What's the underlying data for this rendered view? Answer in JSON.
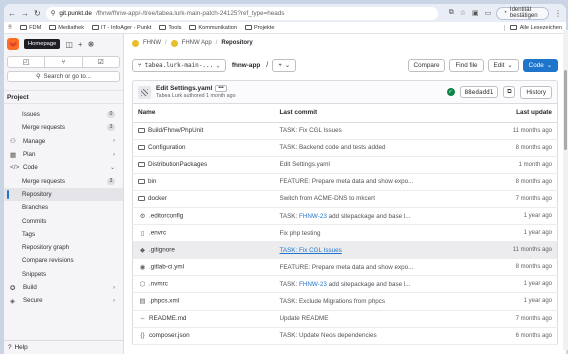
{
  "browser": {
    "url_host": "git.punkt.de",
    "url_path": "/fhnw/fhnw-app/-/tree/tabea.lurk-main-patch-24125?ref_type=heads",
    "verify_label": "Identität bestätigen",
    "bookmarks": [
      "FDM",
      "Mediathek",
      "IT - InfoAger - Punkt",
      "Tools",
      "Kommunikation",
      "Projekte"
    ],
    "all_bookmarks": "Alle Lesezeichen"
  },
  "sidebar": {
    "tooltip": "Homepage",
    "search": "Search or go to...",
    "section": "Project",
    "items": [
      {
        "label": "Issues",
        "badge": "0",
        "sub": true
      },
      {
        "label": "Merge requests",
        "badge": "3",
        "sub": true
      },
      {
        "label": "Manage",
        "icon": "group-icon",
        "glyph": "⚇",
        "chev": "›"
      },
      {
        "label": "Plan",
        "icon": "calendar-icon",
        "glyph": "▦",
        "chev": "›"
      },
      {
        "label": "Code",
        "icon": "code-icon",
        "glyph": "</>",
        "chev": "⌄"
      },
      {
        "label": "Merge requests",
        "badge": "3",
        "sub": true
      },
      {
        "label": "Repository",
        "sub": true,
        "active": true
      },
      {
        "label": "Branches",
        "sub": true
      },
      {
        "label": "Commits",
        "sub": true
      },
      {
        "label": "Tags",
        "sub": true
      },
      {
        "label": "Repository graph",
        "sub": true
      },
      {
        "label": "Compare revisions",
        "sub": true
      },
      {
        "label": "Snippets",
        "sub": true
      },
      {
        "label": "Build",
        "icon": "rocket-icon",
        "glyph": "✪",
        "chev": "›"
      },
      {
        "label": "Secure",
        "icon": "shield-icon",
        "glyph": "◈",
        "chev": "›"
      }
    ],
    "help": "Help"
  },
  "breadcrumb": [
    "FHNW",
    "FHNW App",
    "Repository"
  ],
  "toolbar": {
    "branch": "tabea.lurk-main-...",
    "path": "fhnw-app",
    "path_sep": "/",
    "add": "+",
    "compare": "Compare",
    "find_file": "Find file",
    "edit": "Edit",
    "code": "Code"
  },
  "commit": {
    "title": "Edit Settings.yaml",
    "author": "Tabea Lurk authored 1 month ago",
    "sha": "88edadd1",
    "history": "History"
  },
  "table": {
    "headers": [
      "Name",
      "Last commit",
      "Last update"
    ],
    "rows": [
      {
        "name": "Build/Fhnw/PhpUnit",
        "type": "folder",
        "msg": "TASK: Fix CGL Issues",
        "date": "11 months ago"
      },
      {
        "name": "Configuration",
        "type": "folder",
        "msg": "TASK: Backend code and tests added",
        "date": "8 months ago"
      },
      {
        "name": "DistributionPackages",
        "type": "folder",
        "msg": "Edit Settings.yaml",
        "date": "1 month ago"
      },
      {
        "name": "bin",
        "type": "folder",
        "msg": "FEATURE: Prepare meta data and show expo...",
        "date": "8 months ago"
      },
      {
        "name": "docker",
        "type": "folder",
        "msg": "Switch from ACME-DNS to mkcert",
        "date": "7 months ago"
      },
      {
        "name": ".editorconfig",
        "type": "file",
        "glyph": "⚙",
        "msg_link": "FHNW-23",
        "msg": " add sitepackage and base l...",
        "date": "1 year ago"
      },
      {
        "name": ".envrc",
        "type": "file",
        "glyph": "▯",
        "msg": "Fix php testing",
        "date": "1 year ago"
      },
      {
        "name": ".gitignore",
        "type": "file",
        "glyph": "◆",
        "msg": "TASK: Fix CGL Issues",
        "date": "11 months ago",
        "hover": true
      },
      {
        "name": ".gitlab-ci.yml",
        "type": "file",
        "glyph": "◉",
        "msg": "FEATURE: Prepare meta data and show expo...",
        "date": "8 months ago"
      },
      {
        "name": ".nvmrc",
        "type": "file",
        "glyph": "⬡",
        "msg_link": "FHNW-23",
        "msg": " add sitepackage and base l...",
        "date": "1 year ago"
      },
      {
        "name": ".phpcs.xml",
        "type": "file",
        "glyph": "▤",
        "msg": "TASK: Exclude Migrations from phpcs",
        "date": "1 year ago"
      },
      {
        "name": "README.md",
        "type": "file",
        "glyph": "⇔",
        "msg": "Update README",
        "date": "7 months ago"
      },
      {
        "name": "composer.json",
        "type": "file",
        "glyph": "{}",
        "msg": "TASK: Update Neos dependencies",
        "date": "6 months ago"
      }
    ]
  },
  "colors": {
    "accent": "#1f75cb",
    "success": "#108548",
    "logo": "#fc6d26"
  }
}
